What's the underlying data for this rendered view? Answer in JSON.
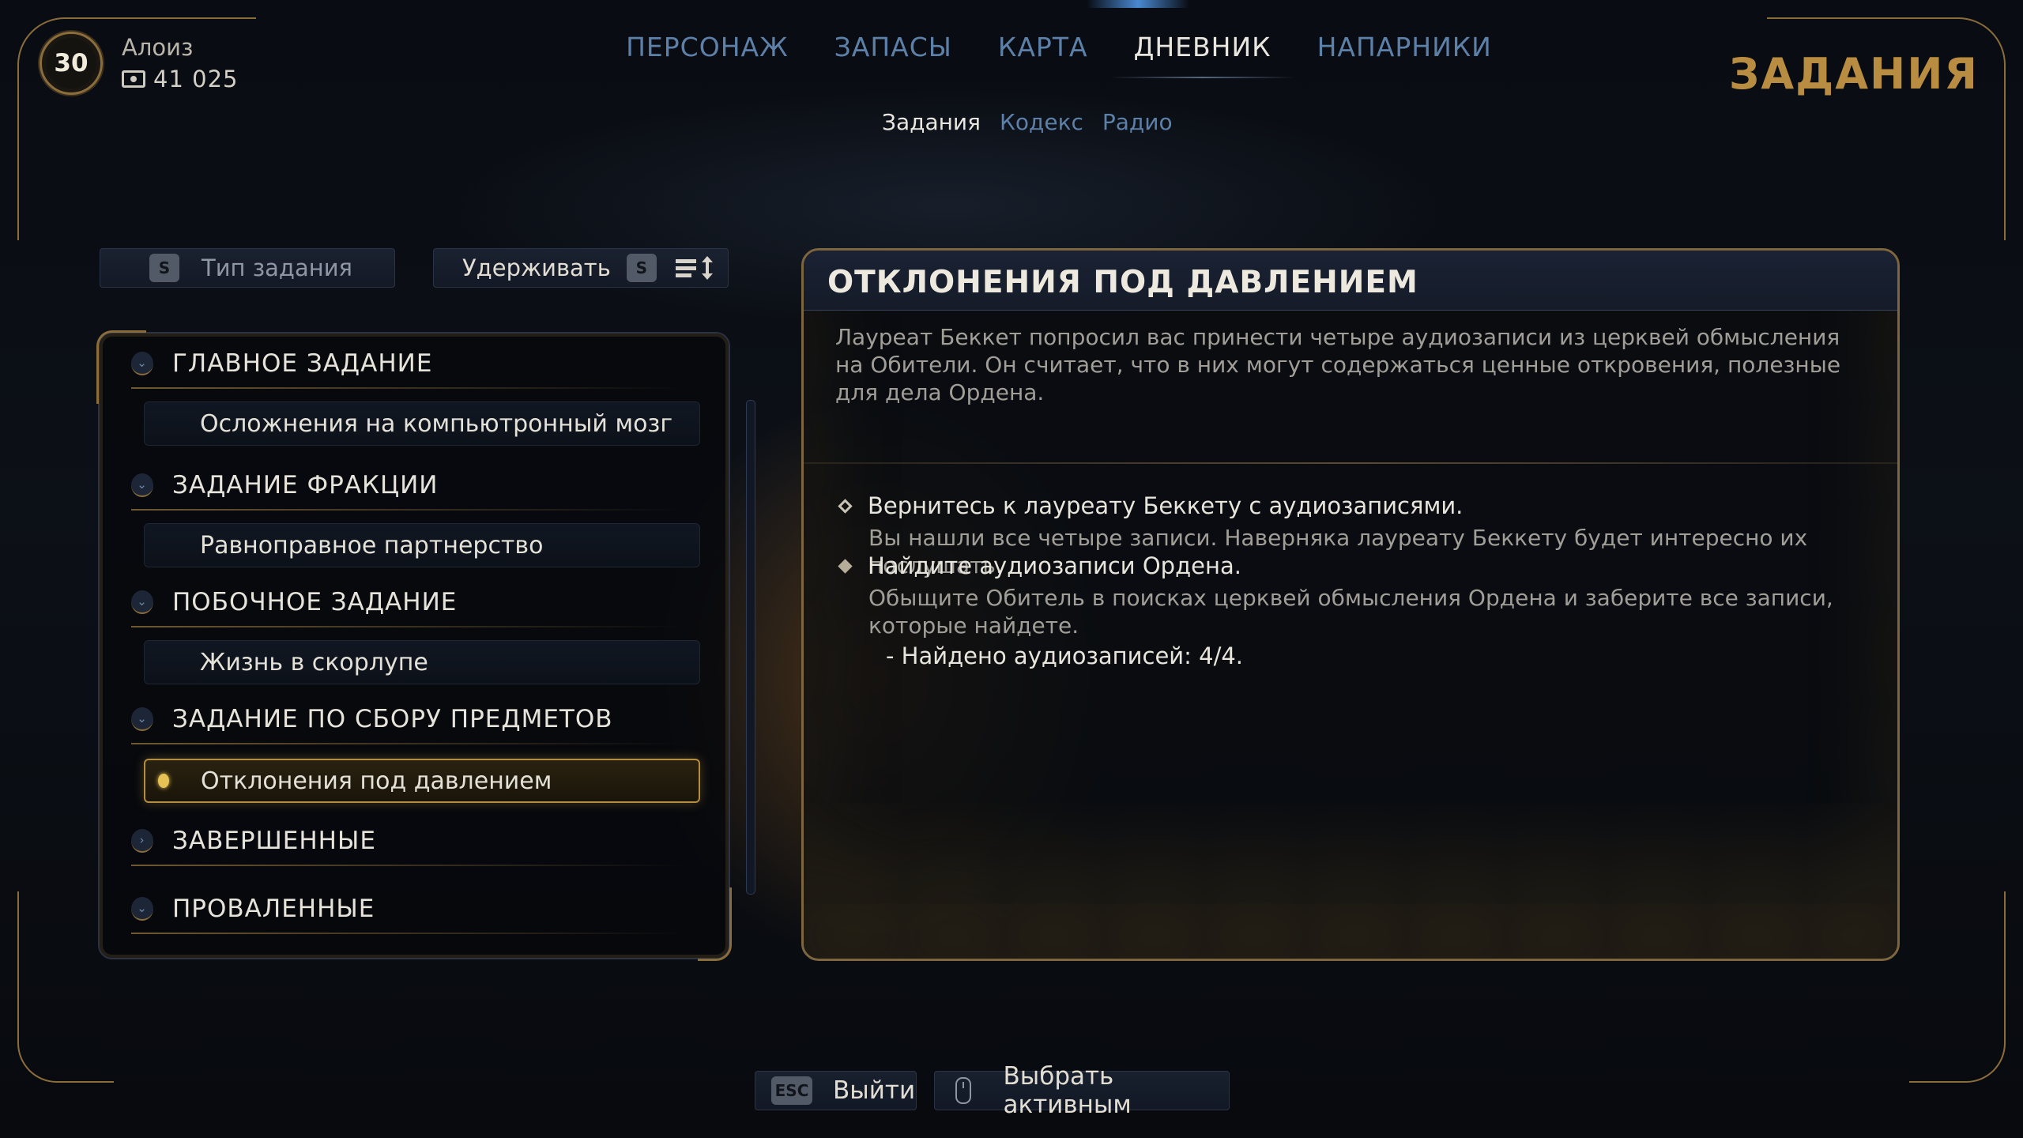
{
  "player": {
    "level": "30",
    "name": "Алоиз",
    "currency": "41 025",
    "currency_icon": "currency-icon"
  },
  "nav": {
    "tabs": [
      {
        "label": "ПЕРСОНАЖ"
      },
      {
        "label": "ЗАПАСЫ"
      },
      {
        "label": "КАРТА"
      },
      {
        "label": "ДНЕВНИК"
      },
      {
        "label": "НАПАРНИКИ"
      }
    ],
    "active": "ДНЕВНИК"
  },
  "subnav": {
    "tabs": [
      {
        "label": "Задания"
      },
      {
        "label": "Кодекс"
      },
      {
        "label": "Радио"
      }
    ],
    "active": "Задания"
  },
  "screen_title": "ЗАДАНИЯ",
  "filters": {
    "type_key": "S",
    "type_label": "Тип задания",
    "hold_label": "Удерживать",
    "hold_key": "S",
    "sort_icon": "sort-icon"
  },
  "quest_list": {
    "categories": [
      {
        "label": "ГЛАВНОЕ ЗАДАНИЕ",
        "quests": [
          "Осложнения на компьютронный мозг"
        ]
      },
      {
        "label": "ЗАДАНИЕ ФРАКЦИИ",
        "quests": [
          "Равноправное партнерство"
        ]
      },
      {
        "label": "ПОБОЧНОЕ ЗАДАНИЕ",
        "quests": [
          "Жизнь в скорлупе"
        ]
      },
      {
        "label": "ЗАДАНИЕ ПО СБОРУ ПРЕДМЕТОВ",
        "quests": [
          "Отклонения под давлением"
        ]
      },
      {
        "label": "ЗАВЕРШЕННЫЕ",
        "quests": []
      },
      {
        "label": "ПРОВАЛЕННЫЕ",
        "quests": []
      }
    ],
    "selected": "Отклонения под давлением"
  },
  "detail": {
    "title": "ОТКЛОНЕНИЯ ПОД ДАВЛЕНИЕМ",
    "description": "Лауреат Беккет попросил вас принести четыре аудиозаписи из церквей обмысления на Обители. Он считает, что в них могут содержаться ценные откровения, полезные для дела Ордена.",
    "objectives": [
      {
        "title": "Вернитесь к лауреату Беккету с аудиозаписями.",
        "description": "Вы нашли все четыре записи. Наверняка лауреату Беккету будет интересно их послушать.",
        "status": "open"
      },
      {
        "title": "Найдите аудиозаписи Ордена.",
        "description": "Обыщите Обитель в поисках церквей обмысления Ордена и заберите все записи, которые найдете.",
        "subtask": "- Найдено аудиозаписей: 4/4.",
        "status": "done"
      }
    ]
  },
  "footer": {
    "exit_key": "ESC",
    "exit_label": "Выйти",
    "select_icon": "mouse-icon",
    "select_label": "Выбрать активным"
  },
  "colors": {
    "gold": "#b88d42",
    "nav_inactive": "#5d80a8",
    "nav_active": "#e8e6df",
    "frame": "#8a6d3b"
  }
}
